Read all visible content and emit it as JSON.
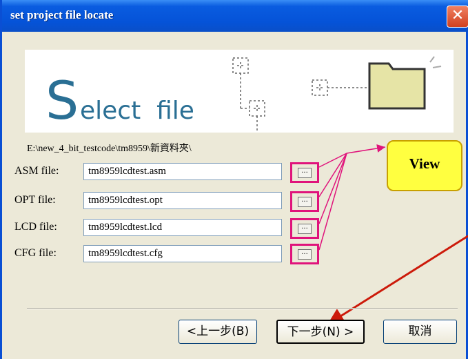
{
  "window": {
    "title": "set project file locate",
    "close_glyph": "✕"
  },
  "banner": {
    "big_letter": "S",
    "rest_text": "elect  file"
  },
  "path": "E:\\new_4_bit_testcode\\tm8959\\新資料夾\\",
  "files": [
    {
      "label": "ASM file:",
      "value": "tm8959lcdtest.asm",
      "browse": "..."
    },
    {
      "label": "OPT file:",
      "value": "tm8959lcdtest.opt",
      "browse": "..."
    },
    {
      "label": "LCD file:",
      "value": "tm8959lcdtest.lcd",
      "browse": "..."
    },
    {
      "label": "CFG file:",
      "value": "tm8959lcdtest.cfg",
      "browse": "..."
    }
  ],
  "callout": {
    "text": "View"
  },
  "buttons": {
    "back": "<上一步(B)",
    "next": "下一步(N) >",
    "cancel": "取消"
  },
  "colors": {
    "accent": "#0a5ce0",
    "highlight": "#e0137b",
    "callout": "#ffff40",
    "arrow": "#cc1a0a"
  }
}
